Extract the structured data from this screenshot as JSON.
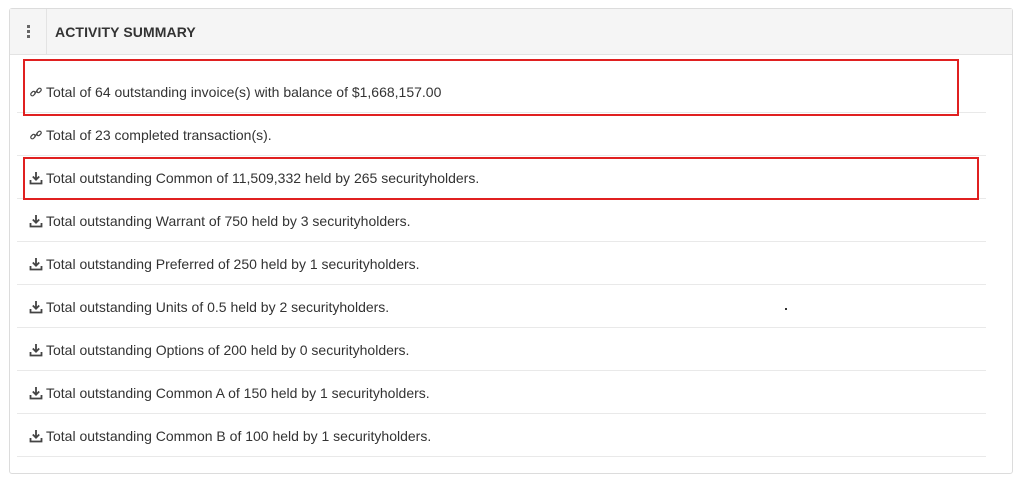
{
  "panel": {
    "title": "ACTIVITY SUMMARY",
    "icons": {
      "handle": "vertical-ellipsis-icon"
    }
  },
  "rows": [
    {
      "icon": "link-icon",
      "text": "Total of 64 outstanding invoice(s) with balance of $1,668,157.00"
    },
    {
      "icon": "link-icon",
      "text": "Total of 23 completed transaction(s)."
    },
    {
      "icon": "download-icon",
      "text": "Total outstanding Common of 11,509,332 held by 265 securityholders."
    },
    {
      "icon": "download-icon",
      "text": "Total outstanding Warrant of 750 held by 3 securityholders."
    },
    {
      "icon": "download-icon",
      "text": "Total outstanding Preferred of 250 held by 1 securityholders."
    },
    {
      "icon": "download-icon",
      "text": "Total outstanding Units of 0.5 held by 2 securityholders."
    },
    {
      "icon": "download-icon",
      "text": "Total outstanding Options of 200 held by 0 securityholders."
    },
    {
      "icon": "download-icon",
      "text": "Total outstanding Common A of 150 held by 1 securityholders."
    },
    {
      "icon": "download-icon",
      "text": "Total outstanding Common B of 100 held by 1 securityholders."
    }
  ],
  "colors": {
    "highlight": "#e02020",
    "text": "#333333",
    "header_bg": "#f5f5f5",
    "border": "#dcdcdc"
  }
}
